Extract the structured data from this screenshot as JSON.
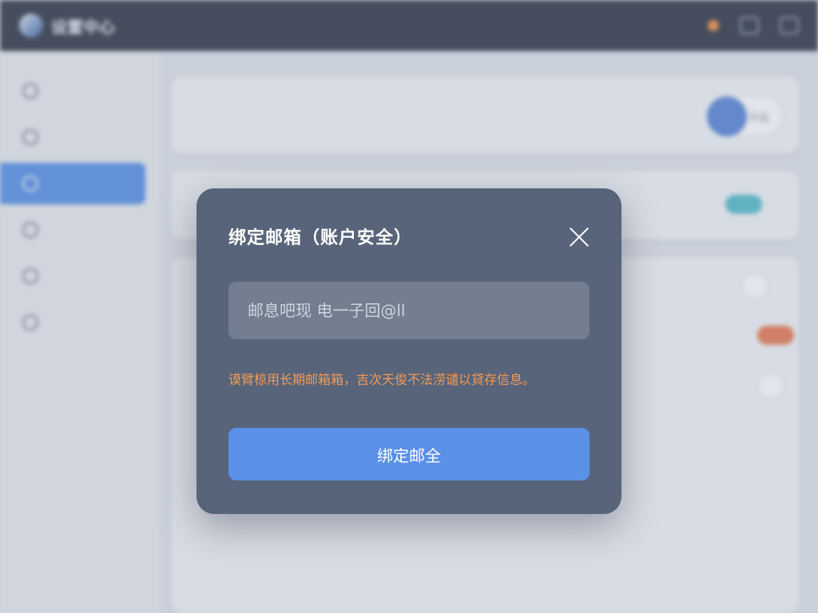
{
  "modal": {
    "title": "绑定邮箱（账户安全）",
    "input_placeholder": "邮息吧现 电一子回@ll",
    "warning": "谟臂椋用长期邮箱箱，吉次天俊不法涝谴以貸存信息。",
    "button_label": "绑定邮全"
  },
  "background": {
    "app_title": "设置中心",
    "header_toggle_label": "开启",
    "colors": {
      "topbar": "#262d3d",
      "sidebar_active": "#4f8be6",
      "modal": "#586479",
      "warning": "#f29a57",
      "button": "#5a90e8",
      "pill_teal": "#4bb8c7",
      "pill_orange": "#e8734a"
    }
  }
}
